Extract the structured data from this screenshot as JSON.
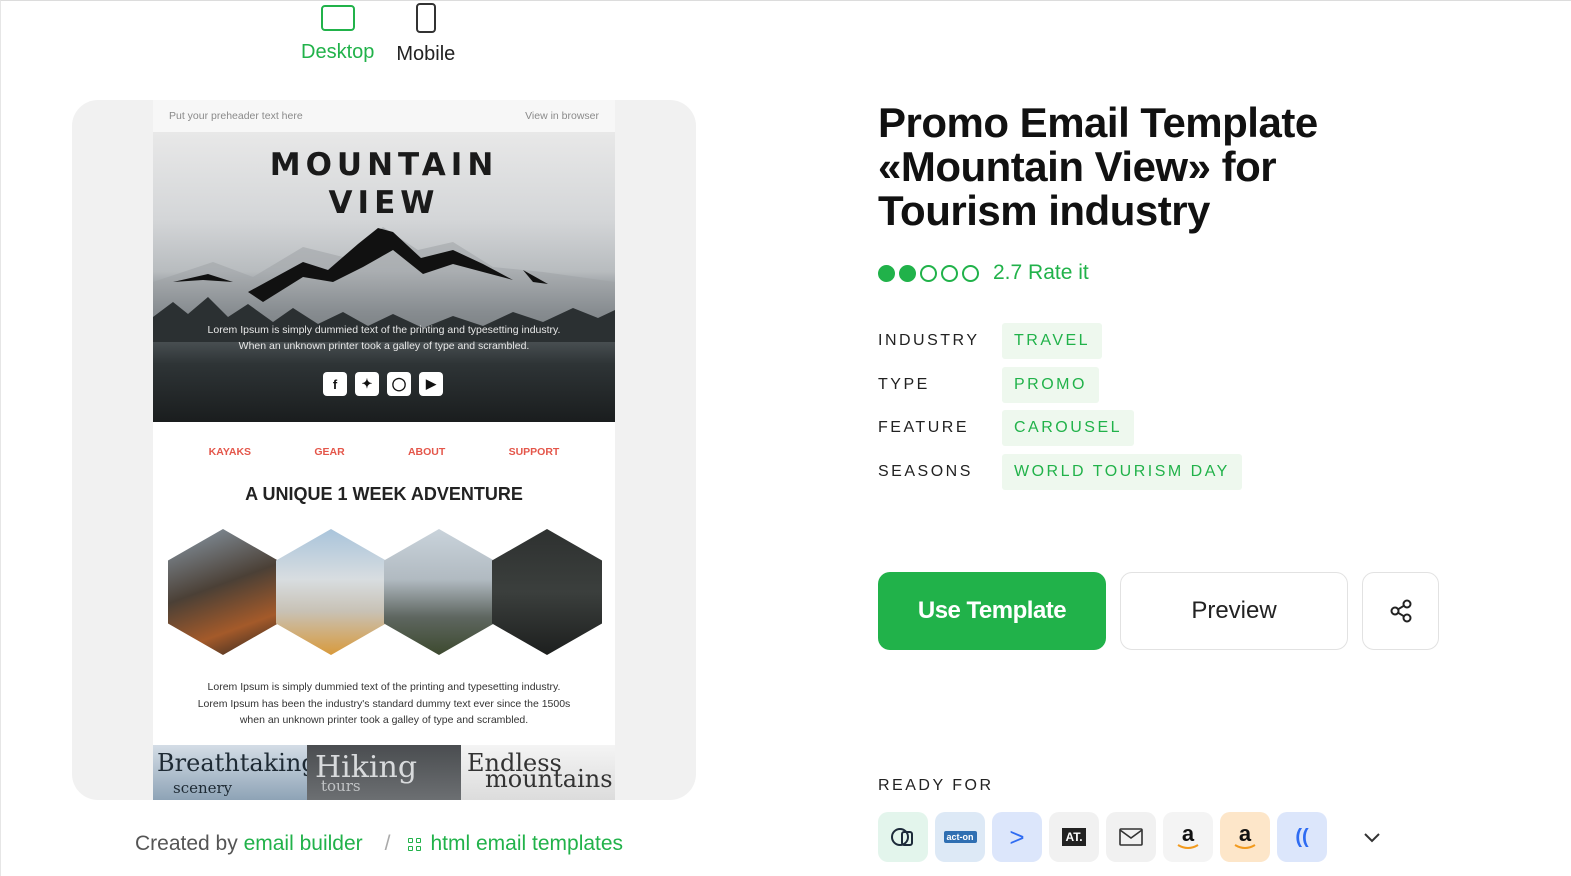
{
  "view_switch": {
    "desktop_label": "Desktop",
    "mobile_label": "Mobile",
    "active": "Desktop"
  },
  "email_preview": {
    "preheader_left": "Put your preheader text here",
    "preheader_right": "View in browser",
    "hero_title_line1": "MOUNTAIN",
    "hero_title_line2": "VIEW",
    "hero_text_line1": "Lorem Ipsum is simply dummied text of the printing and typesetting industry.",
    "hero_text_line2": "When an unknown printer took a galley of type and scrambled.",
    "social_icons": [
      "facebook-icon",
      "twitter-icon",
      "instagram-icon",
      "youtube-icon"
    ],
    "menu": [
      "KAYAKS",
      "GEAR",
      "ABOUT",
      "SUPPORT"
    ],
    "section_title": "A UNIQUE 1 WEEK ADVENTURE",
    "body_line1": "Lorem Ipsum is simply dummied text of the printing and typesetting industry.",
    "body_line2": "Lorem Ipsum has been the industry's standard dummy text ever since the 1500s",
    "body_line3": "when an unknown printer took a galley of type and scrambled.",
    "banners": [
      {
        "big": "Breathtaking",
        "small": "scenery"
      },
      {
        "big": "Hiking",
        "small": "tours"
      },
      {
        "big_line1": "Endless",
        "big_line2": "mountains"
      }
    ]
  },
  "credits": {
    "created_by": "Created by",
    "builder_link": "email builder",
    "separator": "/",
    "templates_link": "html email templates"
  },
  "template": {
    "title_line1": "Promo Email Template",
    "title_line2": "«Mountain View» for",
    "title_line3": "Tourism industry",
    "rating_value": 2.7,
    "rating_text": "2.7 Rate it",
    "rating_filled": 2,
    "rating_total": 5,
    "properties": [
      {
        "key": "INDUSTRY",
        "value": "TRAVEL"
      },
      {
        "key": "TYPE",
        "value": "PROMO"
      },
      {
        "key": "FEATURE",
        "value": "CAROUSEL"
      },
      {
        "key": "SEASONS",
        "value": "WORLD TOURISM DAY"
      }
    ]
  },
  "actions": {
    "use_template": "Use Template",
    "preview": "Preview",
    "share_icon": "share-icon"
  },
  "ready_for": {
    "label": "READY FOR",
    "esps": [
      {
        "icon": "campaign-monitor-icon",
        "text": "",
        "bg": "#e3f5ec"
      },
      {
        "icon": "act-on-icon",
        "text": "act-on",
        "bg": "#dde9f6"
      },
      {
        "icon": "arrow-icon",
        "text": ">",
        "bg": "#dce6fb"
      },
      {
        "icon": "at-icon",
        "text": "AT.",
        "bg": "#f1f1f1"
      },
      {
        "icon": "mail-icon",
        "text": "",
        "bg": "#f1f1f1"
      },
      {
        "icon": "amazon-icon",
        "text": "a",
        "bg": "#f4f4f4"
      },
      {
        "icon": "amazon-ses-icon",
        "text": "a",
        "bg": "#fde6c9"
      },
      {
        "icon": "signal-icon",
        "text": "((",
        "bg": "#dce6fb"
      }
    ]
  },
  "colors": {
    "accent": "#21b24a",
    "accent_bg": "#eef8ee",
    "menu_red": "#e4564a"
  }
}
